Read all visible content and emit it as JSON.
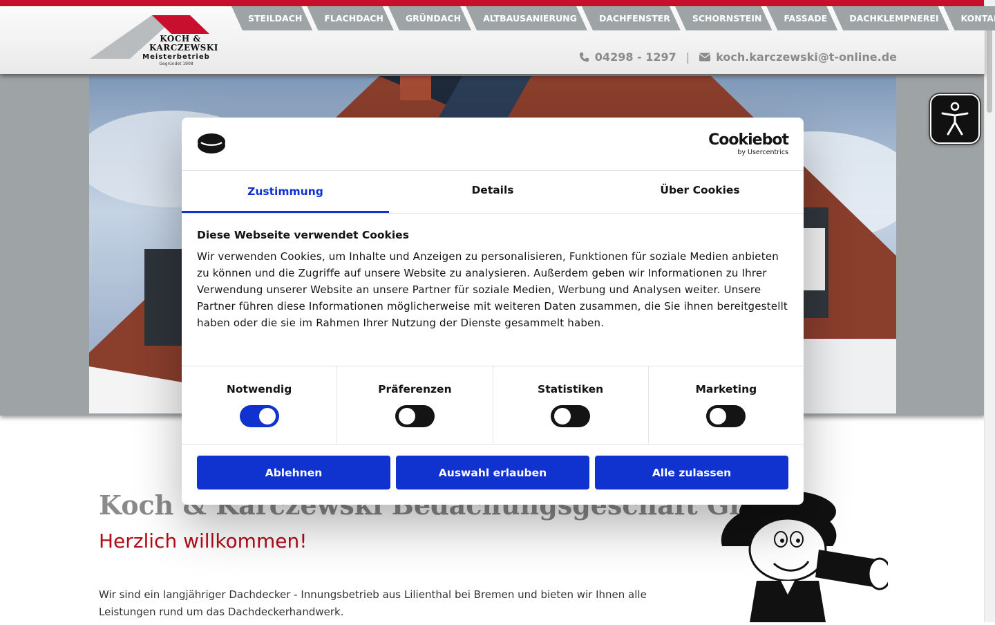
{
  "logo": {
    "line1": "KOCH &",
    "line2": "KARCZEWSKI",
    "line3": "Meisterbetrieb",
    "line4": "Gegründet 1908"
  },
  "nav": [
    "STEILDACH",
    "FLACHDACH",
    "GRÜNDACH",
    "ALTBAUSANIERUNG",
    "DACHFENSTER",
    "SCHORNSTEIN",
    "FASSADE",
    "DACHKLEMPNEREI",
    "KONTAKT"
  ],
  "contact": {
    "phone": "04298 - 1297",
    "separator": "|",
    "email": "koch.karczewski@t-online.de",
    "phone_icon": "phone-icon",
    "email_icon": "envelope-icon"
  },
  "main": {
    "company": "Koch & Karczewski Bedachungsgeschäft GmbH",
    "welcome": "Herzlich willkommen!",
    "intro": "Wir sind ein langjähriger Dachdecker - Innungsbetrieb aus Lilienthal bei Bremen und bieten wir Ihnen alle Leistungen rund um das Dachdeckerhandwerk."
  },
  "cookie": {
    "brand": "Cookiebot",
    "brand_sub": "by Usercentrics",
    "tabs": [
      "Zustimmung",
      "Details",
      "Über Cookies"
    ],
    "title": "Diese Webseite verwendet Cookies",
    "text": "Wir verwenden Cookies, um Inhalte und Anzeigen zu personalisieren, Funktionen für soziale Medien anbieten zu können und die Zugriffe auf unsere Website zu analysieren. Außerdem geben wir Informationen zu Ihrer Verwendung unserer Website an unsere Partner für soziale Medien, Werbung und Analysen weiter. Unsere Partner führen diese Informationen möglicherweise mit weiteren Daten zusammen, die Sie ihnen bereitgestellt haben oder die sie im Rahmen Ihrer Nutzung der Dienste gesammelt haben.",
    "categories": [
      {
        "label": "Notwendig",
        "on": true
      },
      {
        "label": "Präferenzen",
        "on": false
      },
      {
        "label": "Statistiken",
        "on": false
      },
      {
        "label": "Marketing",
        "on": false
      }
    ],
    "buttons": {
      "decline": "Ablehnen",
      "allow_selection": "Auswahl erlauben",
      "allow_all": "Alle zulassen"
    },
    "accent": "#1032cf"
  },
  "colors": {
    "brand_red": "#c8102e",
    "nav_grey": "#9ea3a5",
    "welcome_red": "#b10c16"
  }
}
